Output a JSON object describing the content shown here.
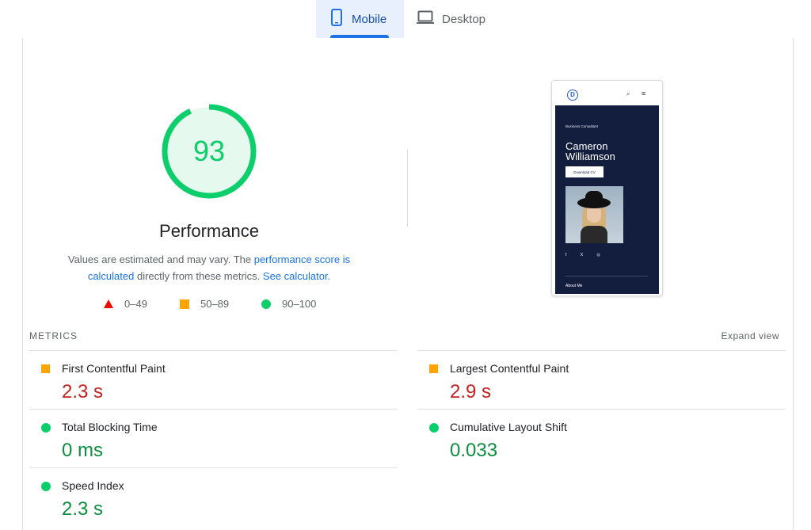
{
  "tabs": [
    {
      "label": "Mobile",
      "icon": "smartphone-icon",
      "selected": true
    },
    {
      "label": "Desktop",
      "icon": "laptop-icon",
      "selected": false
    }
  ],
  "performance": {
    "score": "93",
    "score_fraction": 0.93,
    "title": "Performance",
    "desc_prefix": "Values are estimated and may vary. The ",
    "desc_link1": "performance score is calculated",
    "desc_middle": " directly from these metrics. ",
    "desc_link2": "See calculator.",
    "color_pass": "#0cce6b",
    "color_average": "#ffa400",
    "color_fail": "#eb0f00"
  },
  "legend": [
    {
      "shape": "triangle",
      "label": "0–49"
    },
    {
      "shape": "square",
      "label": "50–89"
    },
    {
      "shape": "circle",
      "label": "90–100"
    }
  ],
  "preview": {
    "logo": "D",
    "kicker": "Business Consultant",
    "name": "Cameron Williamson",
    "button": "Download CV",
    "social": "f X ◎",
    "section": "About Me"
  },
  "metrics": {
    "header": "METRICS",
    "expand": "Expand view",
    "items": [
      {
        "name": "First Contentful Paint",
        "value": "2.3 s",
        "rating": "average"
      },
      {
        "name": "Largest Contentful Paint",
        "value": "2.9 s",
        "rating": "average"
      },
      {
        "name": "Total Blocking Time",
        "value": "0 ms",
        "rating": "pass"
      },
      {
        "name": "Cumulative Layout Shift",
        "value": "0.033",
        "rating": "pass"
      },
      {
        "name": "Speed Index",
        "value": "2.3 s",
        "rating": "pass"
      }
    ]
  }
}
